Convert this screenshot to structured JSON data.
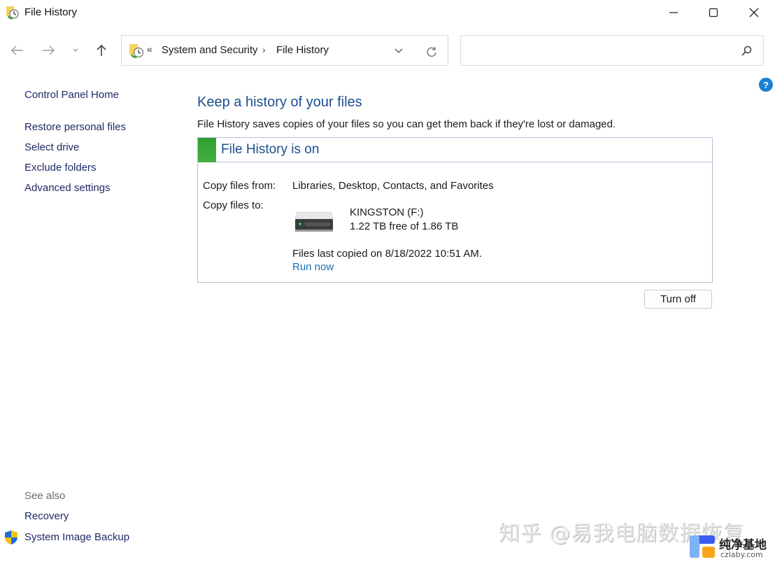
{
  "window": {
    "title": "File History",
    "controls": {
      "minimize": "minimize",
      "maximize": "maximize",
      "close": "close"
    }
  },
  "nav": {
    "back": "back-arrow-icon",
    "forward": "forward-arrow-icon",
    "recent": "chevron-down-icon",
    "up": "up-arrow-icon"
  },
  "address_bar": {
    "overflow": "«",
    "breadcrumbs": [
      "System and Security",
      "File History"
    ],
    "separator": "›"
  },
  "search": {
    "placeholder": "",
    "value": ""
  },
  "help": {
    "label": "?"
  },
  "sidebar": {
    "home": "Control Panel Home",
    "items": [
      {
        "label": "Restore personal files"
      },
      {
        "label": "Select drive"
      },
      {
        "label": "Exclude folders"
      },
      {
        "label": "Advanced settings"
      }
    ],
    "see_also_title": "See also",
    "see_also": [
      {
        "label": "Recovery"
      },
      {
        "label": "System Image Backup"
      }
    ]
  },
  "main": {
    "heading": "Keep a history of your files",
    "description": "File History saves copies of your files so you can get them back if they're lost or damaged.",
    "status": {
      "text": "File History is on",
      "color": "#2f9e2f"
    },
    "copy_from_label": "Copy files from:",
    "copy_from_value": "Libraries, Desktop, Contacts, and Favorites",
    "copy_to_label": "Copy files to:",
    "drive_name": "KINGSTON (F:)",
    "drive_space": "1.22 TB free of 1.86 TB",
    "last_copied": "Files last copied on 8/18/2022 10:51 AM.",
    "run_now": "Run now",
    "turn_off": "Turn off"
  },
  "watermark": {
    "text": "知乎 @易我电脑数据恢复",
    "brand": "纯净基地",
    "url": "czlaby.com"
  }
}
